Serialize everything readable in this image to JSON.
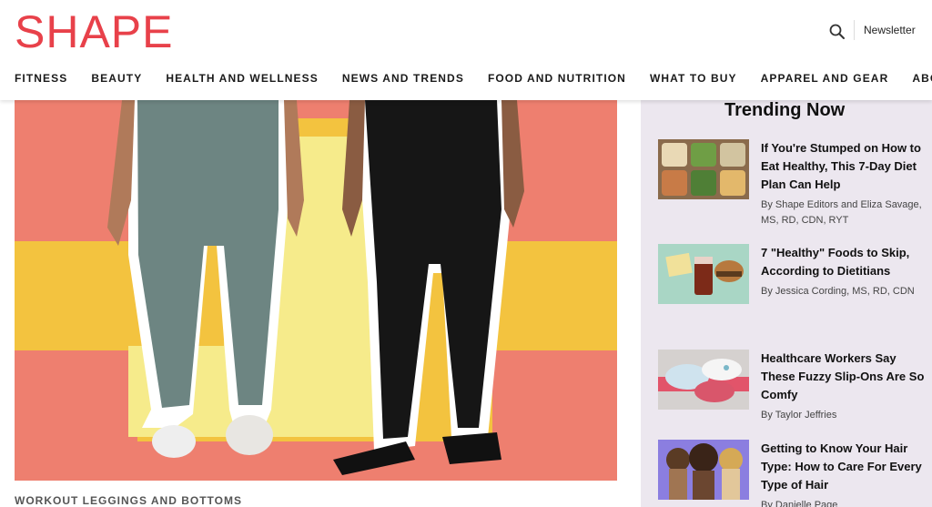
{
  "brand": {
    "logo": "SHAPE",
    "accent": "#e8414a"
  },
  "header": {
    "newsletter": "Newsletter",
    "search_icon": "search-icon"
  },
  "nav": [
    "FITNESS",
    "BEAUTY",
    "HEALTH AND WELLNESS",
    "NEWS AND TRENDS",
    "FOOD AND NUTRITION",
    "WHAT TO BUY",
    "APPAREL AND GEAR",
    "ABOUT US"
  ],
  "hero": {
    "caption": "WORKOUT LEGGINGS AND BOTTOMS"
  },
  "trending": {
    "title": "Trending Now",
    "items": [
      {
        "title": "If You're Stumped on How to Eat Healthy, This 7-Day Diet Plan Can Help",
        "byline": "By Shape Editors and Eliza Savage, MS, RD, CDN, RYT"
      },
      {
        "title": "7 \"Healthy\" Foods to Skip, According to Dietitians",
        "byline": "By Jessica Cording, MS, RD, CDN"
      },
      {
        "title": "Healthcare Workers Say These Fuzzy Slip-Ons Are So Comfy",
        "byline": "By Taylor Jeffries"
      },
      {
        "title": "Getting to Know Your Hair Type: How to Care For Every Type of Hair",
        "byline": "By Danielle Page"
      }
    ]
  }
}
